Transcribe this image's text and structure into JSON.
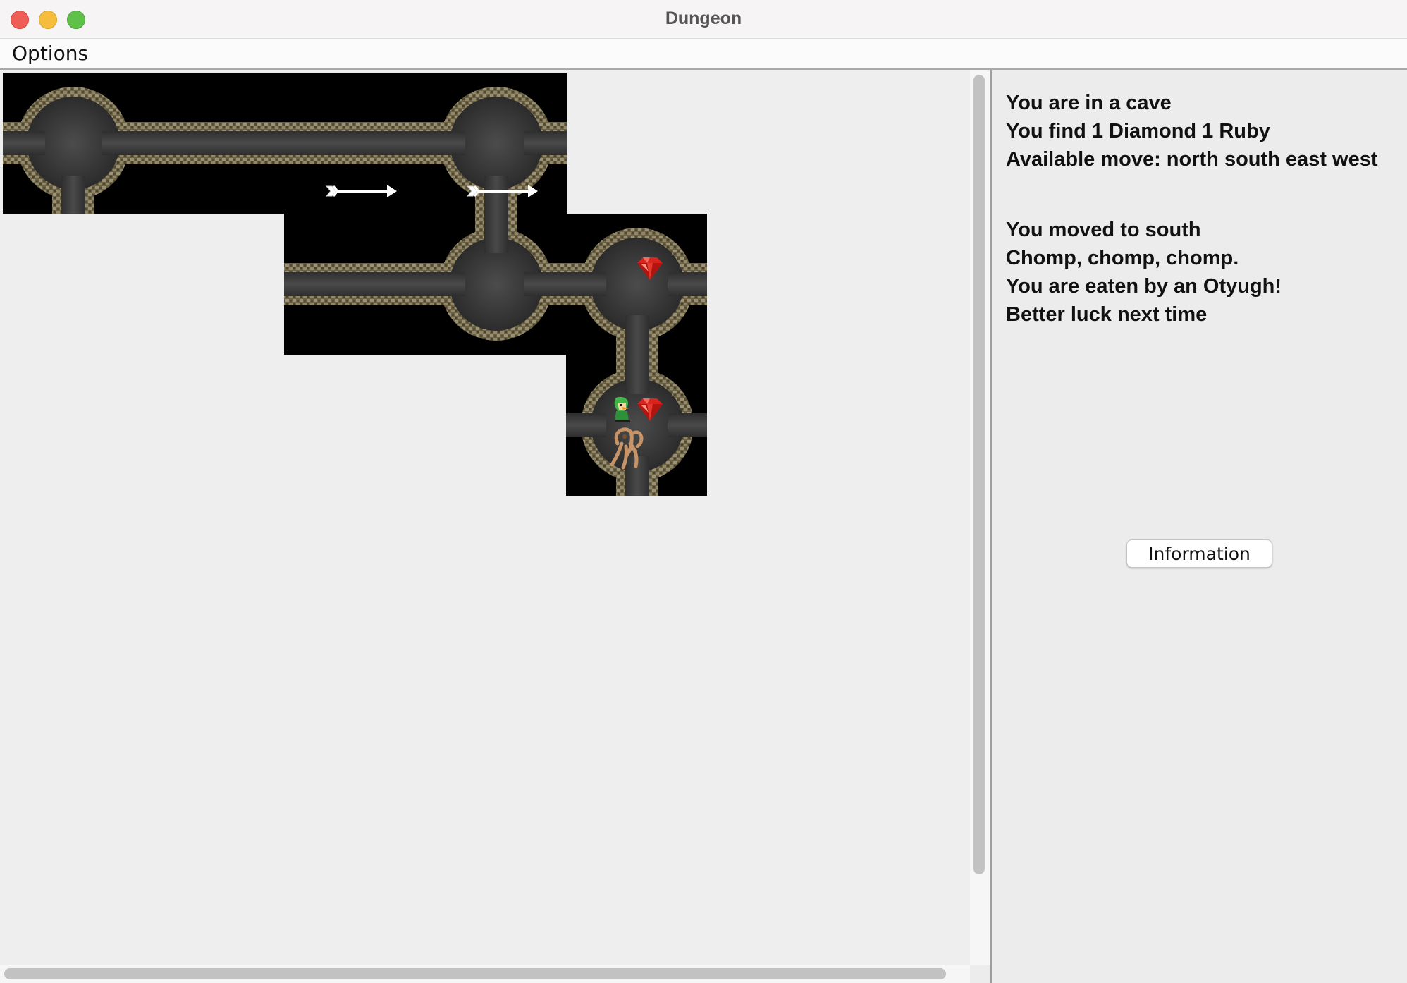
{
  "window": {
    "title": "Dungeon",
    "buttons": [
      "close",
      "minimize",
      "zoom"
    ],
    "colors": {
      "close": "#ee5e57",
      "minimize": "#f5bd3d",
      "zoom": "#5fc04a"
    }
  },
  "menu": {
    "items": [
      {
        "label": "Options"
      }
    ]
  },
  "map": {
    "explored_tiles": 7,
    "tile_contents": [
      {
        "tile": "top-left",
        "items": []
      },
      {
        "tile": "top-corridor",
        "items": [
          "arrow"
        ]
      },
      {
        "tile": "top-right",
        "items": [
          "arrow"
        ]
      },
      {
        "tile": "middle-left",
        "items": []
      },
      {
        "tile": "middle-cave",
        "items": []
      },
      {
        "tile": "middle-right",
        "items": [
          "ruby"
        ]
      },
      {
        "tile": "current-cave",
        "items": [
          "player",
          "ruby",
          "otyugh"
        ]
      }
    ],
    "icons": [
      "arrow-icon",
      "ruby-icon",
      "player-icon",
      "otyugh-icon"
    ]
  },
  "status": {
    "location_lines": [
      "You are in a cave",
      "You find 1 Diamond 1 Ruby",
      "Available move: north south east west"
    ],
    "event_lines": [
      "You moved to south",
      "Chomp, chomp, chomp.",
      "You are eaten by an Otyugh!",
      "Better luck next time"
    ]
  },
  "info_button": {
    "label": "Information"
  }
}
